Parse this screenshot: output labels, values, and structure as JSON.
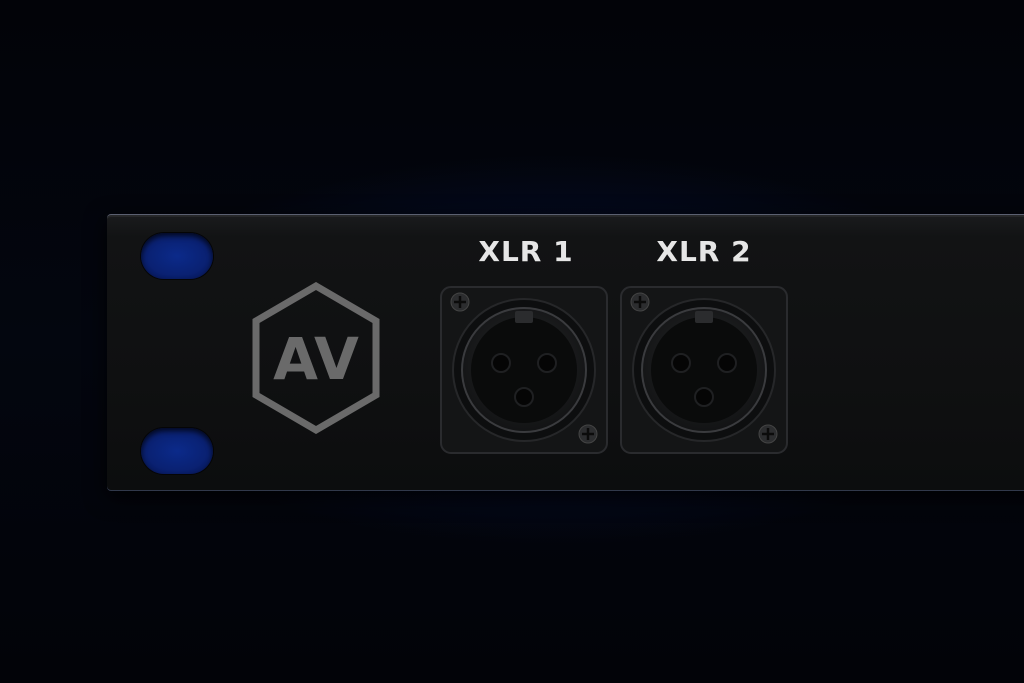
{
  "scene": {
    "description_label": "rack-panel",
    "background_accent": "#0a2c9a",
    "panel_color": "#111213"
  },
  "logo": {
    "text": "AV",
    "color": "#6b6b6b"
  },
  "connectors": [
    {
      "label": "XLR 1",
      "type": "XLR female"
    },
    {
      "label": "XLR 2",
      "type": "XLR female"
    }
  ]
}
